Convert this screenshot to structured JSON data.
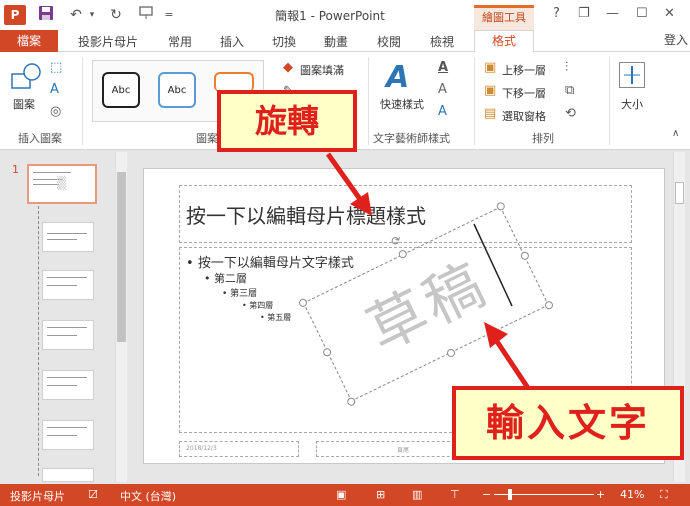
{
  "window": {
    "title": "簡報1 - PowerPoint",
    "context_tab_title": "繪圖工具",
    "signin": "登入",
    "buttons": {
      "help": "?",
      "restore": "❐",
      "minimize": "—",
      "maximize": "☐",
      "close": "✕"
    }
  },
  "quick_access": {
    "save_icon": "floppy-icon",
    "undo_icon": "undo-icon",
    "redo_icon": "redo-icon",
    "present_icon": "present-icon",
    "customize": "="
  },
  "tabs": [
    "檔案",
    "投影片母片",
    "常用",
    "插入",
    "切換",
    "動畫",
    "校閱",
    "檢視",
    "格式"
  ],
  "ribbon": {
    "insert_shapes": {
      "shapes_label": "圖案",
      "group_label": "插入圖案"
    },
    "shape_styles": {
      "style_label": "Abc",
      "group_label": "圖案樣式",
      "fill": "圖案填滿"
    },
    "wordart": {
      "quick_styles": "快速樣式",
      "group_label": "文字藝術師樣式"
    },
    "arrange": {
      "bring_forward": "上移一層",
      "send_backward": "下移一層",
      "selection_pane": "選取窗格",
      "group_label": "排列"
    },
    "size": {
      "label": "大小"
    }
  },
  "thumbnails": {
    "first_number": "1"
  },
  "slide": {
    "title": "按一下以編輯母片標題樣式",
    "body": {
      "level1": "按一下以編輯母片文字樣式",
      "level2": "第二層",
      "level3": "第三層",
      "level4": "第四層",
      "level5": "第五層"
    },
    "watermark": "草稿",
    "footer_date": "2018/12/3",
    "footer_center": "頁尾"
  },
  "callouts": {
    "rotate": "旋轉",
    "input_text": "輸入文字"
  },
  "status": {
    "view_name": "投影片母片",
    "language": "中文 (台灣)",
    "zoom_minus": "−",
    "zoom_plus": "+",
    "zoom": "41%"
  },
  "colors": {
    "accent": "#d24726",
    "callout_border": "#e0211b",
    "callout_fill": "#ffffc8"
  }
}
